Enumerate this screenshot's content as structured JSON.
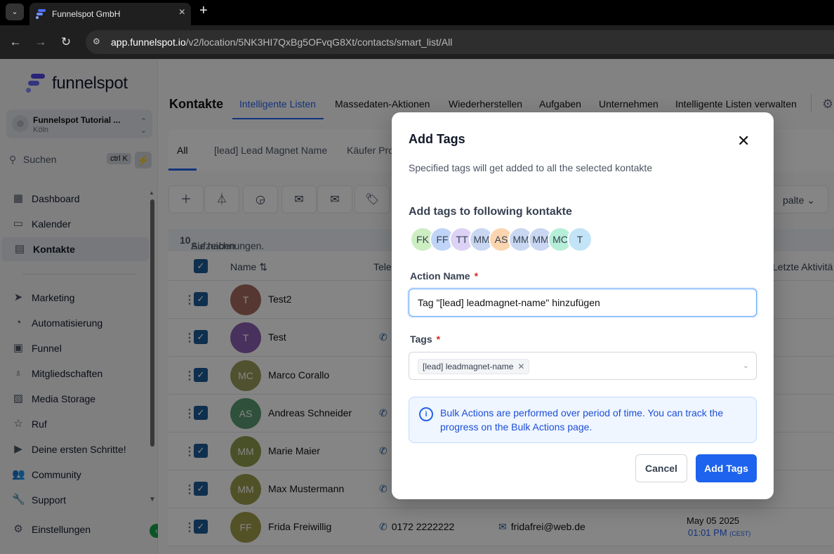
{
  "browser": {
    "tab_title": "Funnelspot GmbH",
    "url_host": "app.funnelspot.io",
    "url_path": "/v2/location/5NK3HI7QxBg5OFvqG8Xt/contacts/smart_list/All"
  },
  "sidebar": {
    "logo_text": "funnelspot",
    "account_name": "Funnelspot Tutorial ...",
    "account_location": "Köln",
    "search_label": "Suchen",
    "search_shortcut": "ctrl K",
    "items": [
      {
        "label": "Dashboard",
        "icon": "dashboard-icon"
      },
      {
        "label": "Kalender",
        "icon": "calendar-icon"
      },
      {
        "label": "Kontakte",
        "icon": "contacts-icon",
        "active": true
      },
      {
        "label": "Marketing",
        "icon": "send-icon"
      },
      {
        "label": "Automatisierung",
        "icon": "automation-icon"
      },
      {
        "label": "Funnel",
        "icon": "funnel-icon"
      },
      {
        "label": "Mitgliedschaften",
        "icon": "badge-icon"
      },
      {
        "label": "Media Storage",
        "icon": "image-icon"
      },
      {
        "label": "Ruf",
        "icon": "star-icon"
      },
      {
        "label": "Deine ersten Schritte!",
        "icon": "play-icon"
      },
      {
        "label": "Community",
        "icon": "users-icon"
      },
      {
        "label": "Support",
        "icon": "wrench-icon"
      },
      {
        "label": "Einstellungen",
        "icon": "gear-icon"
      }
    ]
  },
  "topnav": {
    "title": "Kontakte",
    "tabs": [
      "Intelligente Listen",
      "Massedaten-Aktionen",
      "Wiederherstellen",
      "Aufgaben",
      "Unternehmen",
      "Intelligente Listen verwalten"
    ]
  },
  "subtabs": [
    "All",
    "[lead] Lead Magnet Name",
    "Käufer Pro"
  ],
  "toolbar": {
    "right_label": "palte"
  },
  "selection": {
    "prefix": "Sie haben ausgewählt ",
    "count": "10",
    "suffix": " Aufzeichnungen."
  },
  "table": {
    "col_name": "Name",
    "col_phone": "Tele",
    "col_activity": "Letzte Aktivitä",
    "rows": [
      {
        "initials": "T",
        "name": "Test2",
        "color": "#a86a5e",
        "phone": "",
        "email": "",
        "date": "",
        "time": "",
        "tz": ""
      },
      {
        "initials": "T",
        "name": "Test",
        "color": "#8a5fb0",
        "phone": "",
        "email": "",
        "date": "",
        "time": "",
        "tz": ""
      },
      {
        "initials": "MC",
        "name": "Marco Corallo",
        "color": "#9a9c5a",
        "phone": "",
        "email": "",
        "date": "",
        "time": "",
        "tz": ""
      },
      {
        "initials": "AS",
        "name": "Andreas Schneider",
        "color": "#5a9a72",
        "phone": "",
        "email": "",
        "date": "",
        "time": "",
        "tz": ""
      },
      {
        "initials": "MM",
        "name": "Marie Maier",
        "color": "#8e9c4e",
        "phone": "",
        "email": "",
        "date": "",
        "time": "",
        "tz": ""
      },
      {
        "initials": "MM",
        "name": "Max Mustermann",
        "color": "#9c9c4e",
        "phone": "",
        "email": "",
        "date": "",
        "time": "",
        "tz": ""
      },
      {
        "initials": "FF",
        "name": "Frida Freiwillig",
        "color": "#a09c4a",
        "phone": "0172 2222222",
        "email": "fridafrei@web.de",
        "date": "May 05 2025",
        "time": "01:01 PM",
        "tz": "(CEST)"
      }
    ]
  },
  "modal": {
    "title": "Add Tags",
    "subtitle": "Specified tags will get added to all the selected kontakte",
    "contacts_label": "Add tags to following kontakte",
    "avatars": [
      {
        "initials": "FK",
        "color": "#cdeec3"
      },
      {
        "initials": "FF",
        "color": "#bfd4f7"
      },
      {
        "initials": "TT",
        "color": "#dcd2f5"
      },
      {
        "initials": "MM",
        "color": "#c9d7f2"
      },
      {
        "initials": "AS",
        "color": "#fbd5b0"
      },
      {
        "initials": "MM",
        "color": "#c9d7f2"
      },
      {
        "initials": "MM",
        "color": "#c9d7f2"
      },
      {
        "initials": "MC",
        "color": "#b6efd8"
      },
      {
        "initials": "T",
        "color": "#c3e4f7"
      }
    ],
    "action_name_label": "Action Name",
    "action_name_value": "Tag \"[lead] leadmagnet-name\" hinzufügen",
    "tags_label": "Tags",
    "tag_chip": "[lead] leadmagnet-name",
    "info_text": "Bulk Actions are performed over period of time. You can track the progress on the Bulk Actions page.",
    "cancel_label": "Cancel",
    "submit_label": "Add Tags"
  }
}
